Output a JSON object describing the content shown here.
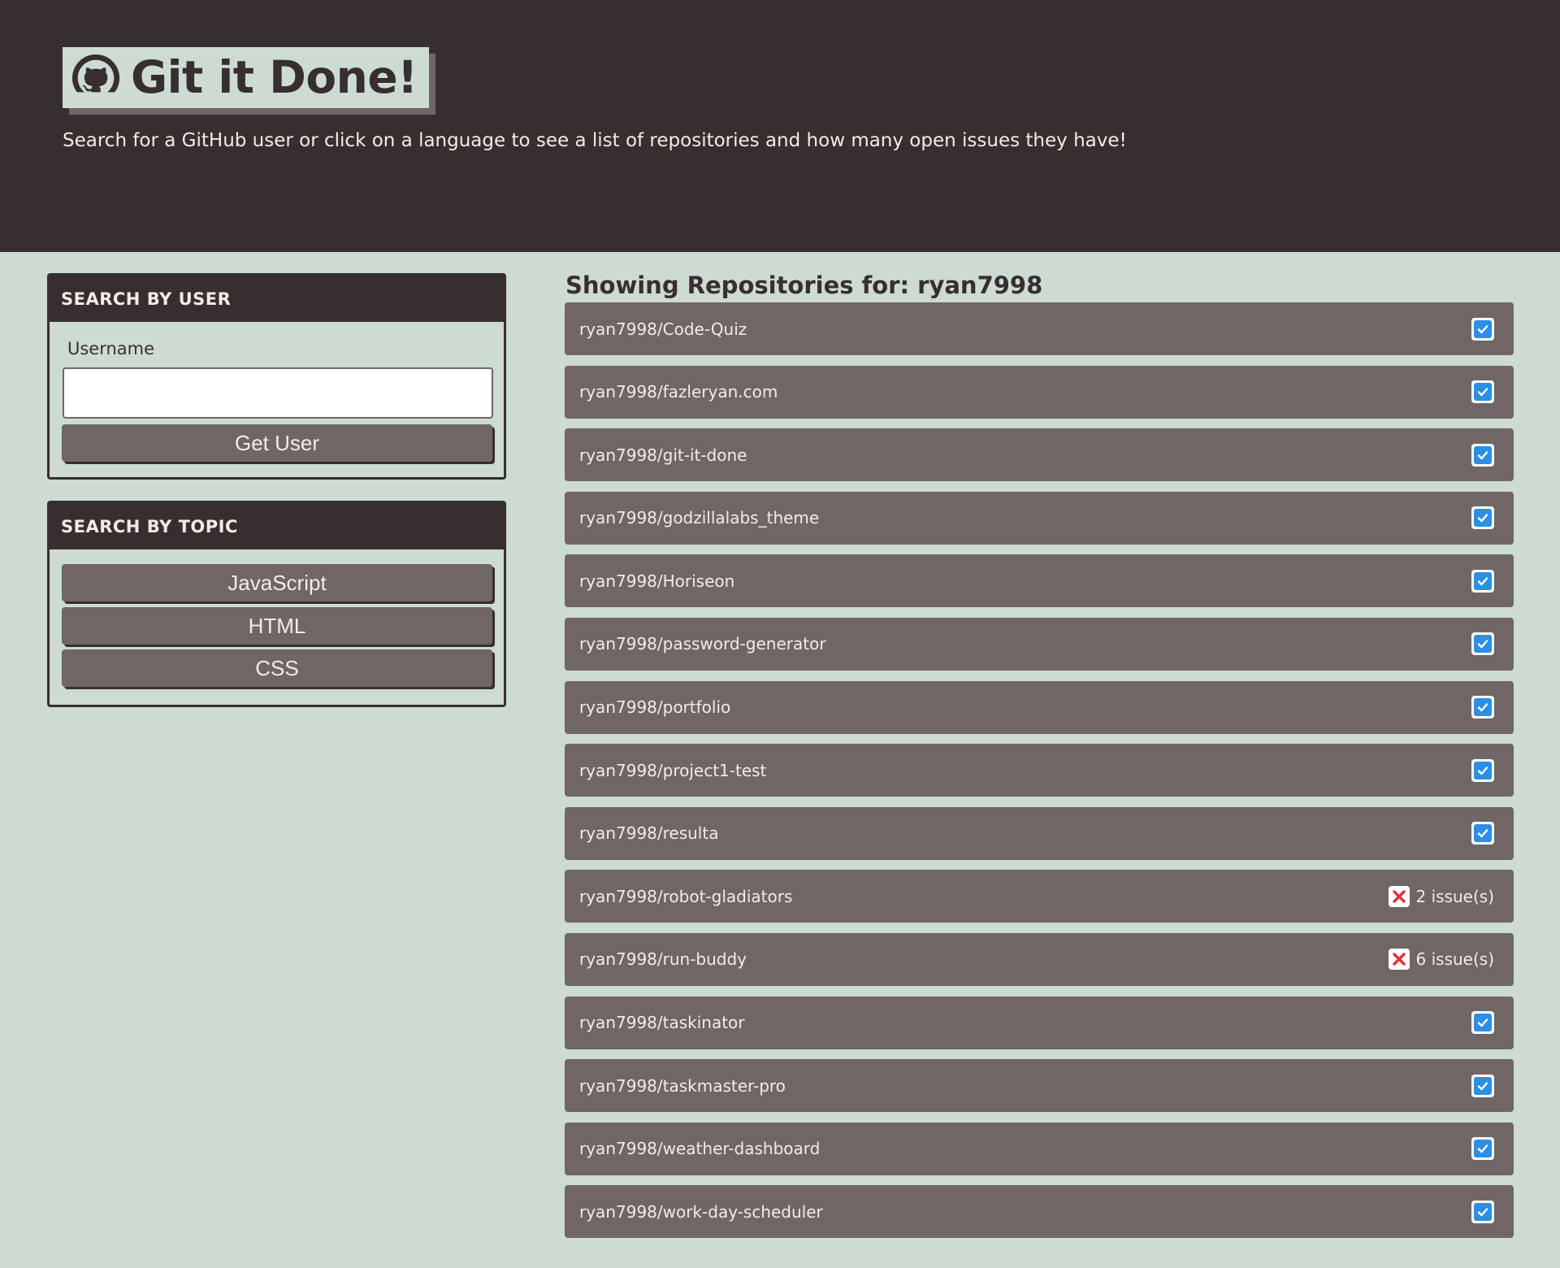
{
  "header": {
    "title": "Git it Done!",
    "subtitle": "Search for a GitHub user or click on a language to see a list of repositories and how many open issues they have!"
  },
  "user_search": {
    "heading": "SEARCH BY USER",
    "label": "Username",
    "value": "",
    "button": "Get User"
  },
  "topic_search": {
    "heading": "SEARCH BY TOPIC",
    "topics": [
      "JavaScript",
      "HTML",
      "CSS"
    ]
  },
  "results": {
    "title": "Showing Repositories for: ryan7998",
    "repos": [
      {
        "name": "ryan7998/Code-Quiz",
        "issues": 0,
        "issue_text": ""
      },
      {
        "name": "ryan7998/fazleryan.com",
        "issues": 0,
        "issue_text": ""
      },
      {
        "name": "ryan7998/git-it-done",
        "issues": 0,
        "issue_text": ""
      },
      {
        "name": "ryan7998/godzillalabs_theme",
        "issues": 0,
        "issue_text": ""
      },
      {
        "name": "ryan7998/Horiseon",
        "issues": 0,
        "issue_text": ""
      },
      {
        "name": "ryan7998/password-generator",
        "issues": 0,
        "issue_text": ""
      },
      {
        "name": "ryan7998/portfolio",
        "issues": 0,
        "issue_text": ""
      },
      {
        "name": "ryan7998/project1-test",
        "issues": 0,
        "issue_text": ""
      },
      {
        "name": "ryan7998/resulta",
        "issues": 0,
        "issue_text": ""
      },
      {
        "name": "ryan7998/robot-gladiators",
        "issues": 2,
        "issue_text": "2 issue(s)"
      },
      {
        "name": "ryan7998/run-buddy",
        "issues": 6,
        "issue_text": "6 issue(s)"
      },
      {
        "name": "ryan7998/taskinator",
        "issues": 0,
        "issue_text": ""
      },
      {
        "name": "ryan7998/taskmaster-pro",
        "issues": 0,
        "issue_text": ""
      },
      {
        "name": "ryan7998/weather-dashboard",
        "issues": 0,
        "issue_text": ""
      },
      {
        "name": "ryan7998/work-day-scheduler",
        "issues": 0,
        "issue_text": ""
      }
    ]
  },
  "icons": {
    "brand": "github-octocat-icon",
    "no_issues": "check-square-icon",
    "has_issues": "x-square-icon"
  },
  "colors": {
    "header_bg": "#372f2f",
    "page_bg": "#cddbd2",
    "row_bg": "#6f6665",
    "check_blue": "#2a8fe6",
    "issue_red": "#e0323c"
  }
}
